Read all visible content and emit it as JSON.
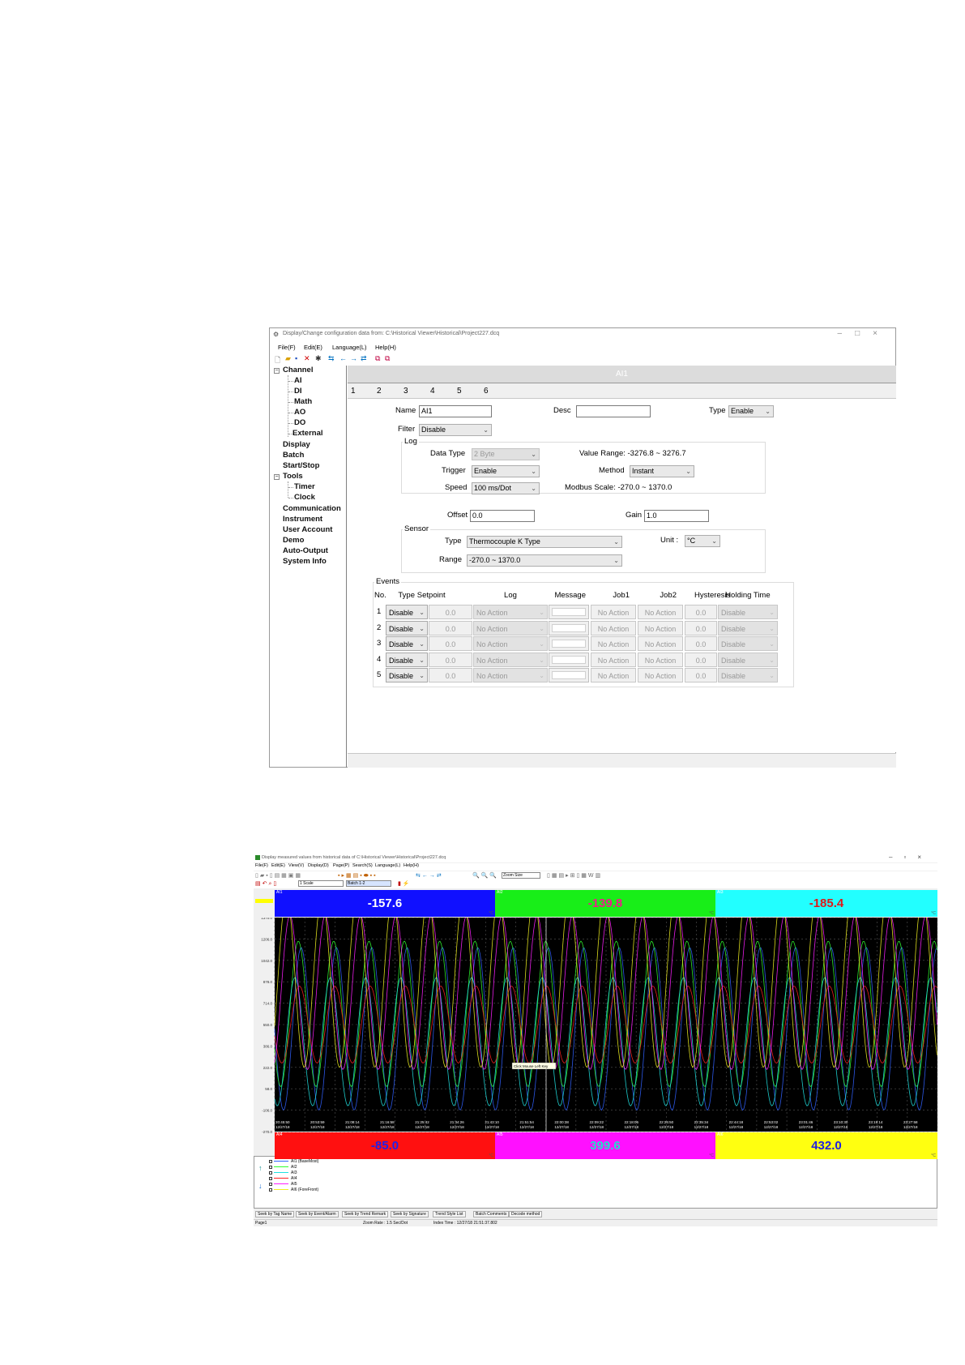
{
  "config_window": {
    "title": "Display/Change configuration data from: C:\\Historical Viewer\\Historical\\Project227.dcq",
    "menu": [
      "File(F)",
      "Edit(E)",
      "Language(L)",
      "Help(H)"
    ],
    "tree": {
      "channel": "Channel",
      "channel_children": [
        "AI",
        "DI",
        "Math",
        "AO",
        "DO",
        "External"
      ],
      "display": "Display",
      "batch": "Batch",
      "start_stop": "Start/Stop",
      "tools": "Tools",
      "tools_children": [
        "Timer",
        "Clock"
      ],
      "rest": [
        "Communication",
        "Instrument",
        "User Account",
        "Demo",
        "Auto-Output",
        "System Info"
      ]
    },
    "header": "AI1",
    "tabs": [
      "1",
      "2",
      "3",
      "4",
      "5",
      "6"
    ],
    "form": {
      "name_label": "Name",
      "name_value": "AI1",
      "desc_label": "Desc",
      "desc_value": "",
      "type_label": "Type",
      "type_value": "Enable",
      "filter_label": "Filter",
      "filter_value": "Disable",
      "log_group": "Log",
      "data_type_label": "Data Type",
      "data_type_value": "2 Byte",
      "value_range": "Value Range: -3276.8 ~ 3276.7",
      "trigger_label": "Trigger",
      "trigger_value": "Enable",
      "method_label": "Method",
      "method_value": "Instant",
      "speed_label": "Speed",
      "speed_value": "100 ms/Dot",
      "modbus_scale": "Modbus Scale:  -270.0 ~ 1370.0",
      "offset_label": "Offset",
      "offset_value": "0.0",
      "gain_label": "Gain",
      "gain_value": "1.0",
      "sensor_group": "Sensor",
      "sensor_type_label": "Type",
      "sensor_type_value": "Thermocouple K Type",
      "unit_label": "Unit :",
      "unit_value": "°C",
      "range_label": "Range",
      "range_value": "-270.0 ~ 1370.0"
    },
    "events": {
      "group": "Events",
      "headers": [
        "No.",
        "Type",
        "Setpoint",
        "Log",
        "Message",
        "Job1",
        "Job2",
        "Hysteresis",
        "Holding Time"
      ],
      "rows": [
        {
          "no": "1",
          "type": "Disable",
          "setpoint": "0.0",
          "log": "No Action",
          "message": "",
          "job1": "No Action",
          "job2": "No Action",
          "hysteresis": "0.0",
          "holding": "Disable"
        },
        {
          "no": "2",
          "type": "Disable",
          "setpoint": "0.0",
          "log": "No Action",
          "message": "",
          "job1": "No Action",
          "job2": "No Action",
          "hysteresis": "0.0",
          "holding": "Disable"
        },
        {
          "no": "3",
          "type": "Disable",
          "setpoint": "0.0",
          "log": "No Action",
          "message": "",
          "job1": "No Action",
          "job2": "No Action",
          "hysteresis": "0.0",
          "holding": "Disable"
        },
        {
          "no": "4",
          "type": "Disable",
          "setpoint": "0.0",
          "log": "No Action",
          "message": "",
          "job1": "No Action",
          "job2": "No Action",
          "hysteresis": "0.0",
          "holding": "Disable"
        },
        {
          "no": "5",
          "type": "Disable",
          "setpoint": "0.0",
          "log": "No Action",
          "message": "",
          "job1": "No Action",
          "job2": "No Action",
          "hysteresis": "0.0",
          "holding": "Disable"
        }
      ]
    }
  },
  "trend_window": {
    "title": "Display measured values from historical data of C:\\Historical Viewer\\Historical\\Project227.dcq",
    "menu": [
      "File(F)",
      "Edit(E)",
      "View(V)",
      "Display(D)",
      "Page(P)",
      "Search(S)",
      "Language(L)",
      "Help(H)"
    ],
    "zoom_select": "Zoom Size",
    "scale_select": "1 Scale",
    "batch_select": "Batch 1-2",
    "panels_top": [
      {
        "tag": "AI1",
        "value": "-157.6",
        "unit": "°C",
        "bg": "#1010ff",
        "fg": "#ffffff"
      },
      {
        "tag": "AI2",
        "value": "-139.8",
        "unit": "°C",
        "bg": "#18ee18",
        "fg": "#f01c8c"
      },
      {
        "tag": "AI3",
        "value": "-185.4",
        "unit": "°C",
        "bg": "#22ffff",
        "fg": "#e01818"
      }
    ],
    "panels_bottom": [
      {
        "tag": "AI4",
        "value": "-85.0",
        "unit": "°C",
        "bg": "#ff1010",
        "fg": "#2020e8"
      },
      {
        "tag": "AI5",
        "value": "399.6",
        "unit": "°C",
        "bg": "#ff10ff",
        "fg": "#22ddcc"
      },
      {
        "tag": "AI6",
        "value": "432.0",
        "unit": "°C",
        "bg": "#ffff10",
        "fg": "#2020e0"
      }
    ],
    "y_ticks": [
      "1370.0",
      "1206.0",
      "1042.0",
      "878.0",
      "714.0",
      "550.0",
      "386.0",
      "222.0",
      "58.0",
      "-106.0",
      "-270.0"
    ],
    "x_ticks": [
      {
        "time": "20:45:50",
        "date": "12/27/18"
      },
      {
        "time": "20:53:59",
        "date": "12/27/18"
      },
      {
        "time": "21:08:14",
        "date": "12/27/18"
      },
      {
        "time": "21:16:58",
        "date": "12/27/18"
      },
      {
        "time": "21:25:42",
        "date": "12/27/18"
      },
      {
        "time": "21:34:26",
        "date": "12/27/18"
      },
      {
        "time": "21:43:10",
        "date": "12/27/18"
      },
      {
        "time": "21:51:54",
        "date": "12/27/18"
      },
      {
        "time": "22:00:38",
        "date": "12/27/18"
      },
      {
        "time": "22:09:22",
        "date": "12/27/18"
      },
      {
        "time": "22:18:06",
        "date": "12/27/18"
      },
      {
        "time": "22:26:50",
        "date": "12/27/18"
      },
      {
        "time": "22:35:34",
        "date": "12/27/18"
      },
      {
        "time": "22:44:18",
        "date": "12/27/18"
      },
      {
        "time": "22:53:02",
        "date": "12/27/18"
      },
      {
        "time": "23:01:46",
        "date": "12/27/18"
      },
      {
        "time": "23:10:30",
        "date": "12/27/18"
      },
      {
        "time": "23:19:14",
        "date": "12/27/18"
      },
      {
        "time": "23:27:58",
        "date": "12/27/18"
      }
    ],
    "tooltip": "Click Mouse Left Key",
    "legend": [
      {
        "name": "AI1 (BaseMost)",
        "color": "#3060ff"
      },
      {
        "name": "AI2",
        "color": "#30ff30"
      },
      {
        "name": "AI3",
        "color": "#20e0e0"
      },
      {
        "name": "AI4",
        "color": "#ff2020"
      },
      {
        "name": "AI5",
        "color": "#ff20ff"
      },
      {
        "name": "AI6 (ForeFront)",
        "color": "#f0f020"
      }
    ],
    "bottom_tabs": [
      "Seek by Tag Name",
      "Seek by Event/Alarm",
      "Seek by Trend Remark",
      "Seek by Signature",
      "Trend Style List",
      "Batch Comments",
      "Decode method"
    ],
    "status": {
      "page": "Page1",
      "zoom_rate": "Zoom Rate : 1.5 Sec/Dot",
      "index_time": "Index Time : 12/27/18 21:51:37.802"
    }
  }
}
